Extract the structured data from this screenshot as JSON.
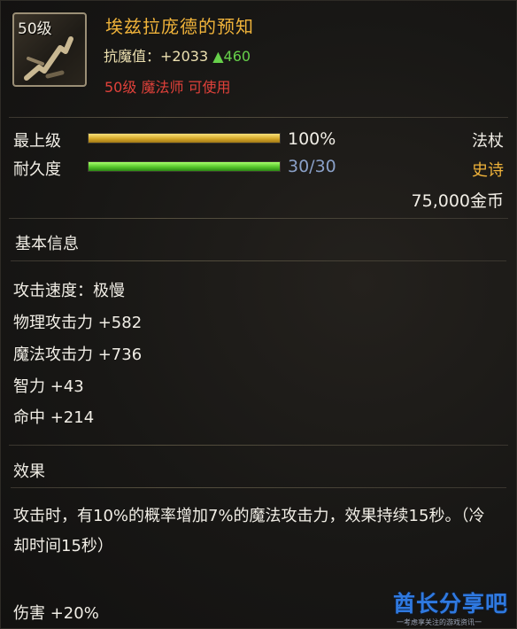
{
  "item": {
    "icon_level": "50级",
    "name": "埃兹拉庞德的预知",
    "resist_label": "抗魔值：",
    "resist_value": "+2033",
    "resist_delta": "▲460",
    "usable_level": "50级 魔法师 可使用"
  },
  "stats": {
    "grade_label": "最上级",
    "grade_value": "100%",
    "grade_fraction": 1.0,
    "durability_label": "耐久度",
    "durability_value": "30/30",
    "durability_fraction": 1.0,
    "weapon_type": "法杖",
    "rarity": "史诗",
    "price": "75,000金币"
  },
  "basic_info": {
    "title": "基本信息",
    "lines": [
      "攻击速度：极慢",
      "物理攻击力 +582",
      "魔法攻击力 +736",
      "智力 +43",
      "命中 +214"
    ]
  },
  "effect": {
    "title": "效果",
    "text": "攻击时，有10%的概率增加7%的魔法攻击力，效果持续15秒。（冷却时间15秒）",
    "damage": "伤害 +20%"
  },
  "watermark": {
    "main": "酋长分享吧",
    "sub": "一考虑享关注的游戏资讯一"
  },
  "colors": {
    "item_name": "#f0b33a",
    "usable": "#e0413a",
    "delta": "#66d04a",
    "rarity": "#f0b33a",
    "durability_value": "#8aa0c8",
    "watermark": "#2f79e0"
  }
}
